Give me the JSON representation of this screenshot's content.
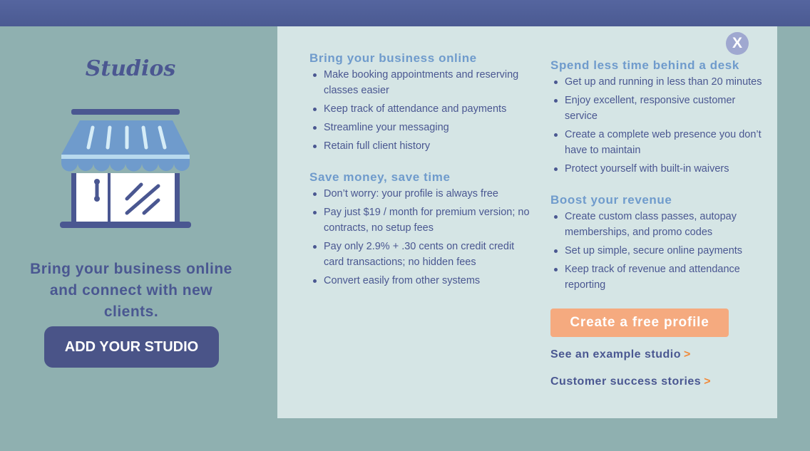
{
  "left": {
    "title": "Studios",
    "tagline": "Bring your business online and connect with new clients.",
    "add_button": "ADD YOUR STUDIO"
  },
  "panel": {
    "close_label": "X",
    "sections_left": [
      {
        "heading": "Bring your business online",
        "items": [
          "Make booking appointments and reserving classes easier",
          "Keep track of attendance and payments",
          "Streamline your messaging",
          "Retain full client history"
        ]
      },
      {
        "heading": "Save money, save time",
        "items": [
          "Don’t worry: your profile is always free",
          "Pay just $19 / month for premium version; no contracts, no setup fees",
          "Pay only 2.9% + .30 cents on credit credit card transactions; no hidden fees",
          "Convert easily from other systems"
        ]
      }
    ],
    "sections_right": [
      {
        "heading": "Spend less time behind a desk",
        "items": [
          "Get up and running in less than 20 minutes",
          "Enjoy excellent, responsive customer service",
          "Create a complete web presence you don’t have to maintain",
          "Protect yourself with built-in waivers"
        ]
      },
      {
        "heading": "Boost your revenue",
        "items": [
          "Create custom class passes, autopay memberships, and promo codes",
          "Set up simple, secure online payments",
          "Keep track of revenue and attendance reporting"
        ]
      }
    ],
    "cta_button": "Create a free profile",
    "link_example": "See an example studio",
    "link_stories": "Customer success stories",
    "link_arrow": ">"
  },
  "colors": {
    "background": "#8fb0b0",
    "top_bar": "#4b5a92",
    "panel": "#d5e5e5",
    "heading_blue": "#6f9bcc",
    "text_navy": "#4a5791",
    "cta_orange": "#f5aa7f",
    "arrow_orange": "#f08a3a"
  },
  "icons": [
    "storefront-icon",
    "close-icon"
  ]
}
